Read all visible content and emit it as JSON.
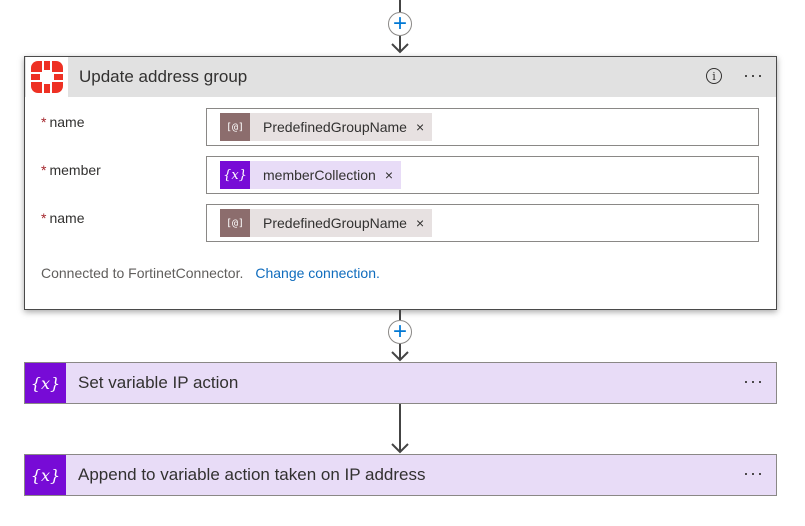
{
  "top_insert": {
    "icon": "plus-icon"
  },
  "update_card": {
    "title": "Update address group",
    "logo": "fortinet-logo",
    "info_icon": "info-icon",
    "more_label": "···",
    "fields": [
      {
        "label": "name",
        "required": "*",
        "token_icon": "[@]",
        "token_text": "PredefinedGroupName",
        "token_type": "group"
      },
      {
        "label": "member",
        "required": "*",
        "token_icon": "{x}",
        "token_text": "memberCollection",
        "token_type": "variable"
      },
      {
        "label": "name",
        "required": "*",
        "token_icon": "[@]",
        "token_text": "PredefinedGroupName",
        "token_type": "group"
      }
    ],
    "remove_label": "×",
    "connection_text": "Connected to FortinetConnector.",
    "change_link": "Change connection."
  },
  "middle_insert": {
    "icon": "plus-icon"
  },
  "set_variable_card": {
    "icon_text": "{x}",
    "title": "Set variable IP action",
    "more_label": "···"
  },
  "append_variable_card": {
    "icon_text": "{x}",
    "title": "Append to variable action taken on IP address",
    "more_label": "···"
  },
  "colors": {
    "variable_purple": "#770bd6",
    "variable_bg": "#e8dcf7",
    "group_brown": "#8c6d6d",
    "link_blue": "#0f6cbd",
    "fortinet_red": "#ee3124"
  }
}
